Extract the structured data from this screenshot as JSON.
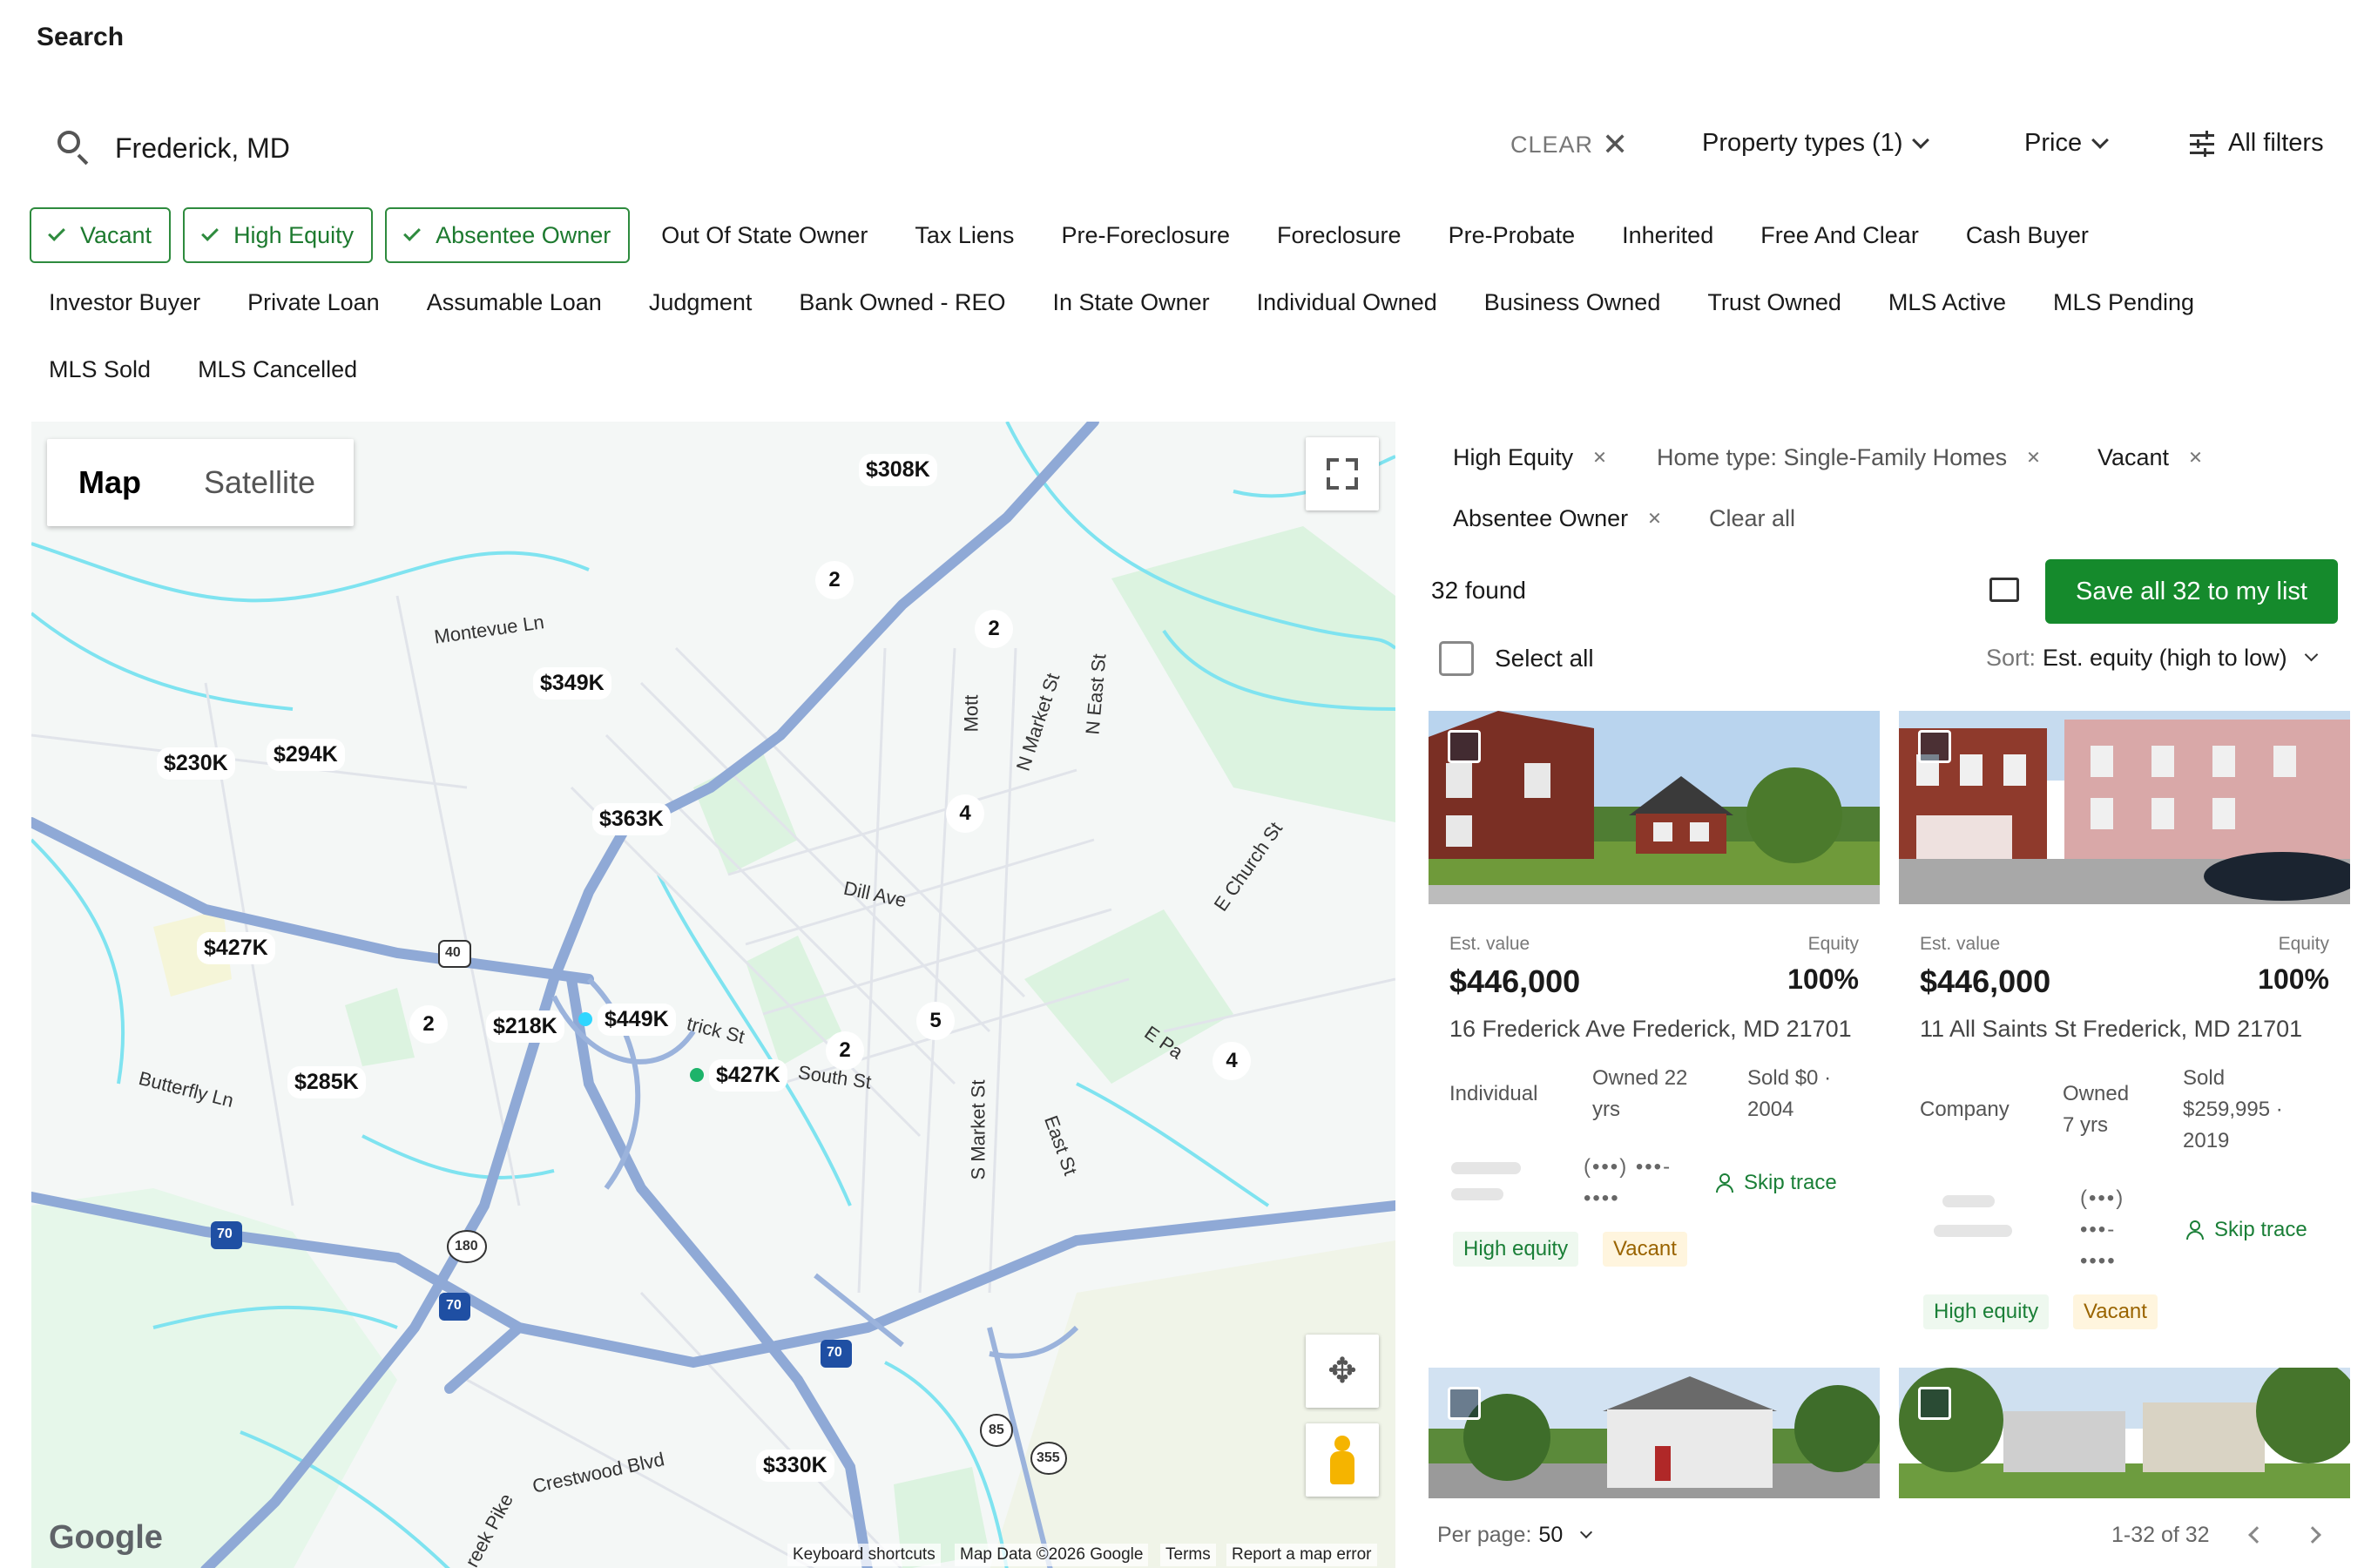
{
  "header": {
    "title": "Search"
  },
  "search": {
    "value": "Frederick, MD",
    "clear_label": "CLEAR",
    "property_types_label": "Property types (1)",
    "price_label": "Price",
    "all_filters_label": "All filters"
  },
  "chips": {
    "row1": [
      {
        "label": "Vacant",
        "selected": true
      },
      {
        "label": "High Equity",
        "selected": true
      },
      {
        "label": "Absentee Owner",
        "selected": true
      },
      {
        "label": "Out Of State Owner",
        "selected": false
      },
      {
        "label": "Tax Liens",
        "selected": false
      },
      {
        "label": "Pre-Foreclosure",
        "selected": false
      },
      {
        "label": "Foreclosure",
        "selected": false
      },
      {
        "label": "Pre-Probate",
        "selected": false
      },
      {
        "label": "Inherited",
        "selected": false
      },
      {
        "label": "Free And Clear",
        "selected": false
      },
      {
        "label": "Cash Buyer",
        "selected": false
      }
    ],
    "row2": [
      {
        "label": "Investor Buyer"
      },
      {
        "label": "Private Loan"
      },
      {
        "label": "Assumable Loan"
      },
      {
        "label": "Judgment"
      },
      {
        "label": "Bank Owned - REO"
      },
      {
        "label": "In State Owner"
      },
      {
        "label": "Individual Owned"
      },
      {
        "label": "Business Owned"
      },
      {
        "label": "Trust Owned"
      },
      {
        "label": "MLS Active"
      },
      {
        "label": "MLS Pending"
      }
    ],
    "row3": [
      {
        "label": "MLS Sold"
      },
      {
        "label": "MLS Cancelled"
      }
    ]
  },
  "map": {
    "tab_map": "Map",
    "tab_satellite": "Satellite",
    "google": "Google",
    "attrib_shortcuts": "Keyboard shortcuts",
    "attrib_data": "Map Data ©2026 Google",
    "attrib_terms": "Terms",
    "attrib_report": "Report a map error",
    "prices": {
      "p308": "$308K",
      "p349": "$349K",
      "p230": "$230K",
      "p294": "$294K",
      "p363": "$363K",
      "p427a": "$427K",
      "p218": "$218K",
      "p449": "$449K",
      "p427b": "$427K",
      "p285": "$285K",
      "p330": "$330K"
    },
    "clusters": {
      "c1": "2",
      "c2": "2",
      "c3": "4",
      "c4": "2",
      "c5": "2",
      "c6": "5",
      "c7": "4"
    },
    "streets": {
      "montevue": "Montevue Ln",
      "dill": "Dill Ave",
      "butterfly": "Butterfly Ln",
      "crestwood": "Crestwood Blvd",
      "mott": "Mott",
      "nmarket": "N Market St",
      "neast": "N East St",
      "echurch": "E Church St",
      "smarket": "S Market St",
      "east": "East St",
      "patrick": "trick St",
      "south": "South St",
      "epa": "E Pa",
      "creekpike": "reek Pike"
    },
    "shields": {
      "us40": "40",
      "i70a": "70",
      "i70b": "70",
      "i70c": "70",
      "md180": "180",
      "md85": "85",
      "md355": "355"
    }
  },
  "results": {
    "active_filters": [
      {
        "label": "High Equity"
      },
      {
        "label": "Home type: Single-Family Homes"
      },
      {
        "label": "Vacant"
      },
      {
        "label": "Absentee Owner"
      }
    ],
    "clear_all": "Clear all",
    "found": "32 found",
    "save_button": "Save all 32 to my list",
    "select_all": "Select all",
    "sort_label": "Sort:",
    "sort_value": "Est. equity (high to low)",
    "cards": [
      {
        "est_label": "Est. value",
        "equity_label": "Equity",
        "est_value": "$446,000",
        "equity_value": "100%",
        "address": "16 Frederick Ave Frederick, MD 21701",
        "owner_type": "Individual",
        "owned_1": "Owned 22",
        "owned_2": "yrs",
        "sold_1": "Sold $0 ·",
        "sold_2": "2004",
        "phone_1": "(•••) •••-",
        "phone_2": "••••",
        "skip": "Skip trace",
        "tag1": "High equity",
        "tag2": "Vacant"
      },
      {
        "est_label": "Est. value",
        "equity_label": "Equity",
        "est_value": "$446,000",
        "equity_value": "100%",
        "address": "11 All Saints St Frederick, MD 21701",
        "owner_type": "Company",
        "owned_1": "Owned",
        "owned_2": "7 yrs",
        "sold_1": "Sold",
        "sold_2": "$259,995 ·",
        "sold_3": "2019",
        "phone_1": "(•••)",
        "phone_2": "•••-",
        "phone_3": "••••",
        "skip": "Skip trace",
        "tag1": "High equity",
        "tag2": "Vacant"
      }
    ],
    "per_page_label": "Per page:",
    "per_page_value": "50",
    "range": "1-32 of 32"
  },
  "colors": {
    "accent": "#158a2c",
    "road": "#8fa9d6",
    "water": "#7fe3f0",
    "park": "#d6f2dc"
  }
}
